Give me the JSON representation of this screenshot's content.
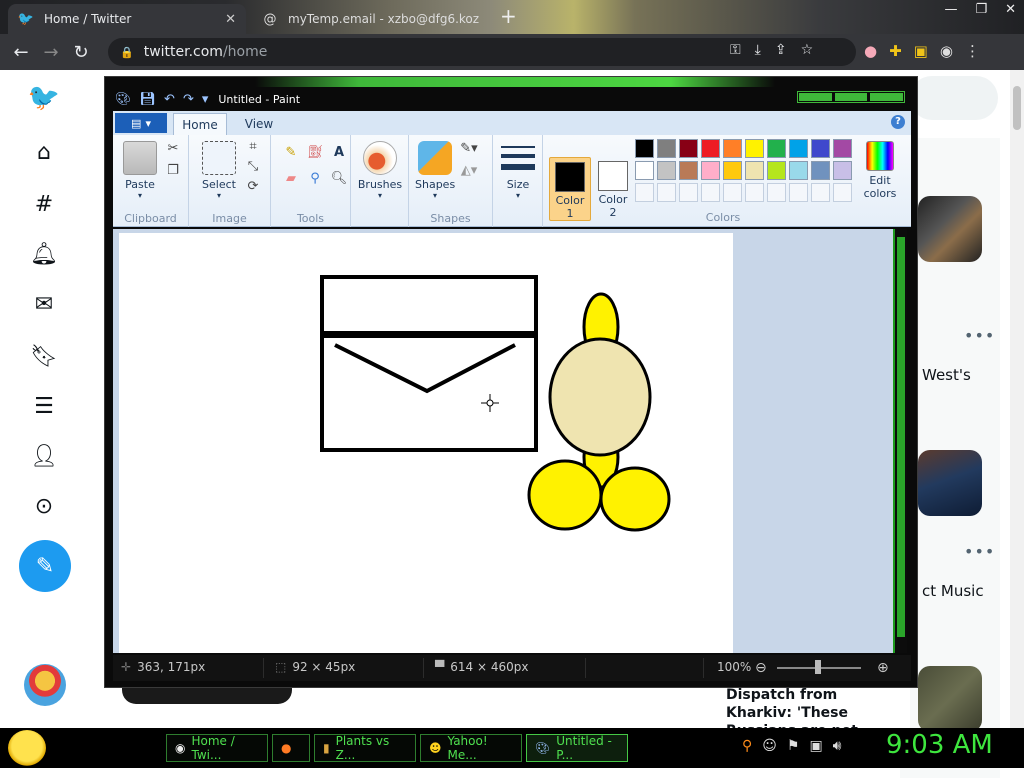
{
  "browser": {
    "tabs": [
      {
        "title": "Home / Twitter",
        "active": true
      },
      {
        "title": "myTemp.email - xzbo@dfg6.koz",
        "active": false
      }
    ],
    "url": {
      "domain": "twitter.com",
      "path": "/home"
    }
  },
  "twitter": {
    "trends": [
      {
        "text": "West's"
      },
      {
        "text": "ct Music"
      }
    ],
    "dispatch_headline": "Dispatch from Kharkiv: 'These Russians are not"
  },
  "paint": {
    "title": "Untitled - Paint",
    "tabs": {
      "file": "",
      "home": "Home",
      "view": "View"
    },
    "groups": {
      "clipboard": "Clipboard",
      "image": "Image",
      "tools": "Tools",
      "shapes": "Shapes",
      "colors": "Colors"
    },
    "buttons": {
      "paste": "Paste",
      "select": "Select",
      "brushes": "Brushes",
      "shapes": "Shapes",
      "size": "Size",
      "color1_line1": "Color",
      "color1_line2": "1",
      "color2_line1": "Color",
      "color2_line2": "2",
      "edit_colors_line1": "Edit",
      "edit_colors_line2": "colors"
    },
    "color1": "#000000",
    "color2": "#ffffff",
    "palette_row1": [
      "#000000",
      "#7f7f7f",
      "#880015",
      "#ed1c24",
      "#ff7f27",
      "#fff200",
      "#22b14c",
      "#00a2e8",
      "#3f48cc",
      "#a349a4"
    ],
    "palette_row2": [
      "#ffffff",
      "#c3c3c3",
      "#b97a57",
      "#ffaec9",
      "#ffc90e",
      "#efe4b0",
      "#b5e61d",
      "#99d9ea",
      "#7092be",
      "#c8bfe7"
    ],
    "status": {
      "cursor": "363, 171px",
      "selection": "92 × 45px",
      "canvas_size": "614 × 460px",
      "zoom": "100%"
    }
  },
  "taskbar": {
    "items": [
      {
        "label": "Home / Twi..."
      },
      {
        "label": ""
      },
      {
        "label": "Plants vs Z..."
      },
      {
        "label": "Yahoo! Me..."
      },
      {
        "label": "Untitled - P..."
      }
    ],
    "clock": "9:03 AM"
  }
}
